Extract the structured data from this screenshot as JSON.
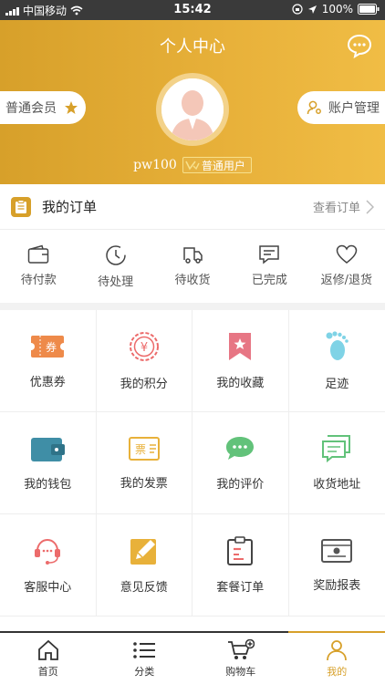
{
  "status_bar": {
    "carrier": "中国移动",
    "time": "15:42",
    "battery": "100%"
  },
  "header": {
    "title": "个人中心",
    "member_level": "普通会员",
    "account_manage": "账户管理",
    "username": "pw100",
    "user_type": "普通用户",
    "accent_color": "#d7a02a"
  },
  "orders": {
    "title": "我的订单",
    "view_all": "查看订单",
    "items": [
      {
        "label": "待付款",
        "icon": "wallet-icon"
      },
      {
        "label": "待处理",
        "icon": "clock-icon"
      },
      {
        "label": "待收货",
        "icon": "truck-icon"
      },
      {
        "label": "已完成",
        "icon": "message-box-icon"
      },
      {
        "label": "返修/退货",
        "icon": "heart-icon"
      }
    ]
  },
  "services": {
    "items": [
      {
        "label": "优惠券",
        "icon": "coupon-icon",
        "icon_text": "券"
      },
      {
        "label": "我的积分",
        "icon": "points-coin-icon",
        "icon_text": "¥"
      },
      {
        "label": "我的收藏",
        "icon": "bookmark-star-icon"
      },
      {
        "label": "足迹",
        "icon": "footprint-icon"
      },
      {
        "label": "我的钱包",
        "icon": "wallet-icon"
      },
      {
        "label": "我的发票",
        "icon": "invoice-icon",
        "icon_text": "票"
      },
      {
        "label": "我的评价",
        "icon": "comment-icon"
      },
      {
        "label": "收货地址",
        "icon": "address-icon"
      },
      {
        "label": "客服中心",
        "icon": "headset-icon"
      },
      {
        "label": "意见反馈",
        "icon": "edit-feedback-icon"
      },
      {
        "label": "套餐订单",
        "icon": "package-order-icon"
      },
      {
        "label": "奖励报表",
        "icon": "report-icon"
      }
    ]
  },
  "tabbar": {
    "items": [
      {
        "label": "首页",
        "icon": "home-icon"
      },
      {
        "label": "分类",
        "icon": "list-icon"
      },
      {
        "label": "购物车",
        "icon": "cart-icon"
      },
      {
        "label": "我的",
        "icon": "user-icon"
      }
    ],
    "active_index": 3
  }
}
